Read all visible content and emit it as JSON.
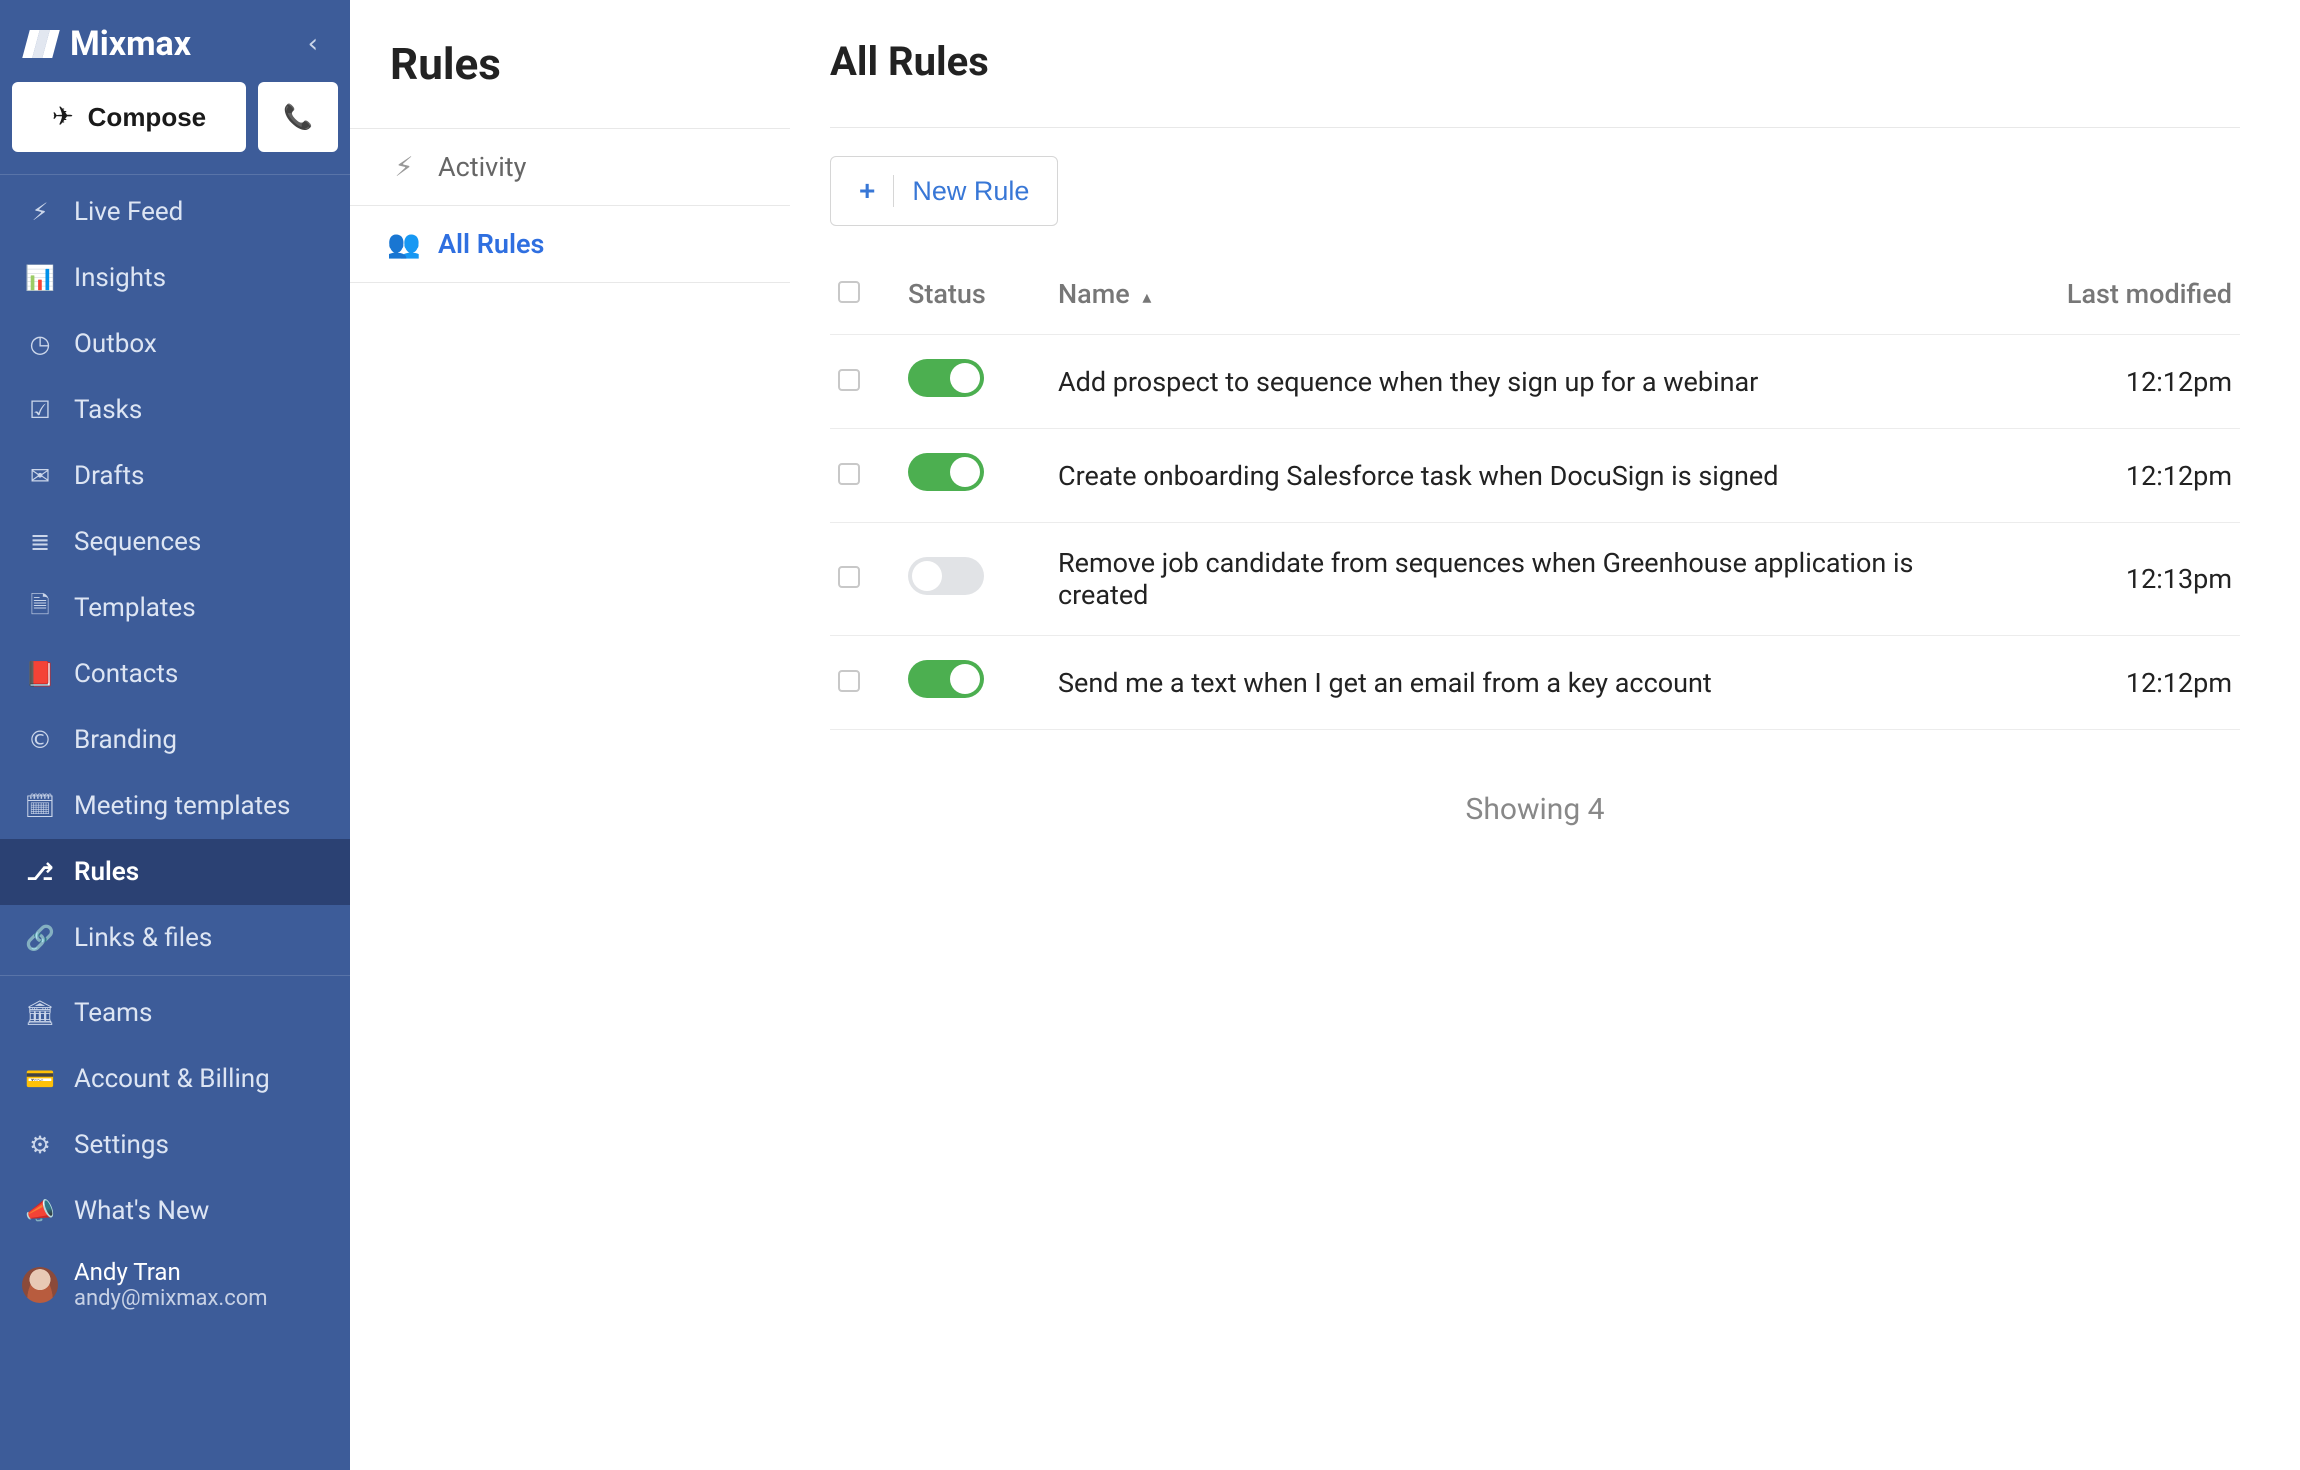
{
  "brand": {
    "name": "Mixmax"
  },
  "compose": {
    "label": "Compose"
  },
  "nav": {
    "items": [
      {
        "id": "live-feed",
        "label": "Live Feed",
        "icon": "bolt"
      },
      {
        "id": "insights",
        "label": "Insights",
        "icon": "chart"
      },
      {
        "id": "outbox",
        "label": "Outbox",
        "icon": "clock"
      },
      {
        "id": "tasks",
        "label": "Tasks",
        "icon": "check"
      },
      {
        "id": "drafts",
        "label": "Drafts",
        "icon": "envelope"
      },
      {
        "id": "sequences",
        "label": "Sequences",
        "icon": "stack"
      },
      {
        "id": "templates",
        "label": "Templates",
        "icon": "file"
      },
      {
        "id": "contacts",
        "label": "Contacts",
        "icon": "book"
      },
      {
        "id": "branding",
        "label": "Branding",
        "icon": "copyright"
      },
      {
        "id": "meeting-templates",
        "label": "Meeting templates",
        "icon": "calendar"
      },
      {
        "id": "rules",
        "label": "Rules",
        "icon": "branch",
        "active": true
      },
      {
        "id": "links-files",
        "label": "Links & files",
        "icon": "link"
      }
    ],
    "items2": [
      {
        "id": "teams",
        "label": "Teams",
        "icon": "building"
      },
      {
        "id": "account-billing",
        "label": "Account & Billing",
        "icon": "card"
      },
      {
        "id": "settings",
        "label": "Settings",
        "icon": "gear"
      },
      {
        "id": "whats-new",
        "label": "What's New",
        "icon": "megaphone"
      }
    ]
  },
  "user": {
    "name": "Andy Tran",
    "email": "andy@mixmax.com"
  },
  "subpanel": {
    "title": "Rules",
    "items": [
      {
        "id": "activity",
        "label": "Activity",
        "icon": "bolt",
        "active": false
      },
      {
        "id": "all-rules",
        "label": "All Rules",
        "icon": "users",
        "active": true
      }
    ]
  },
  "main": {
    "title": "All Rules",
    "new_rule_label": "New Rule",
    "columns": {
      "status": "Status",
      "name": "Name",
      "last_modified": "Last modified"
    },
    "rules": [
      {
        "enabled": true,
        "name": "Add prospect to sequence when they sign up for a webinar",
        "modified": "12:12pm"
      },
      {
        "enabled": true,
        "name": "Create onboarding Salesforce task when DocuSign is signed",
        "modified": "12:12pm"
      },
      {
        "enabled": false,
        "name": "Remove job candidate from sequences when Greenhouse application is created",
        "modified": "12:13pm"
      },
      {
        "enabled": true,
        "name": "Send me a text when I get an email from a key account",
        "modified": "12:12pm"
      }
    ],
    "showing": "Showing 4"
  },
  "icons": {
    "bolt": "⚡",
    "chart": "📊",
    "clock": "◷",
    "check": "☑",
    "envelope": "✉",
    "stack": "≣",
    "file": "🗎",
    "book": "📕",
    "copyright": "©",
    "calendar": "🗓",
    "branch": "⎇",
    "link": "🔗",
    "building": "🏛",
    "card": "💳",
    "gear": "⚙",
    "megaphone": "📣",
    "users": "👥",
    "paperplane": "✈",
    "phone": "📞",
    "chevron-left": "‹"
  }
}
